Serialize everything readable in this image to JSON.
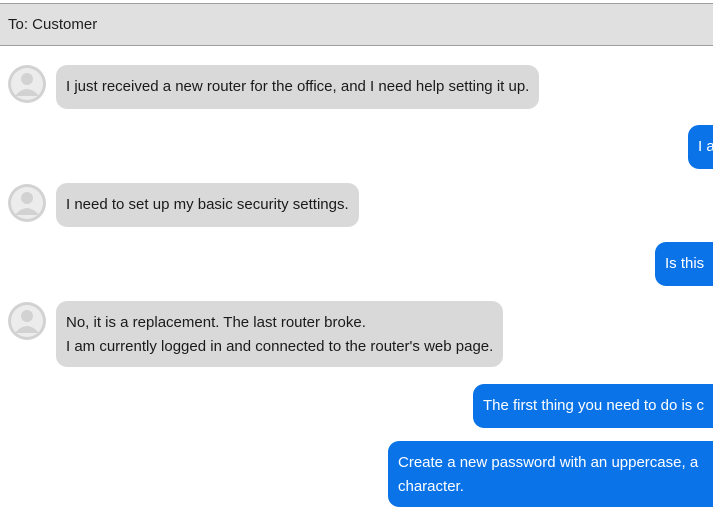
{
  "header": {
    "recipient": "To: Customer"
  },
  "messages": [
    {
      "direction": "in",
      "lines": [
        "I just received a new router for the office, and I need help setting it up."
      ]
    },
    {
      "direction": "out",
      "lines": [
        "I a"
      ]
    },
    {
      "direction": "in",
      "lines": [
        "I need to set up my basic security settings."
      ]
    },
    {
      "direction": "out",
      "lines": [
        "Is this"
      ]
    },
    {
      "direction": "in",
      "lines": [
        "No, it is a replacement. The last router broke.",
        "I am currently logged in and connected to the router's web page."
      ]
    },
    {
      "direction": "out",
      "lines": [
        "The first thing you need to do is c"
      ]
    },
    {
      "direction": "out",
      "lines": [
        "Create a new password with an uppercase, a",
        "character."
      ]
    }
  ],
  "colors": {
    "incoming_bubble": "#d9d9d9",
    "outgoing_bubble": "#0a73e7",
    "header_background": "#e0e0e0"
  },
  "icons": {
    "avatar": "user-avatar-icon"
  }
}
